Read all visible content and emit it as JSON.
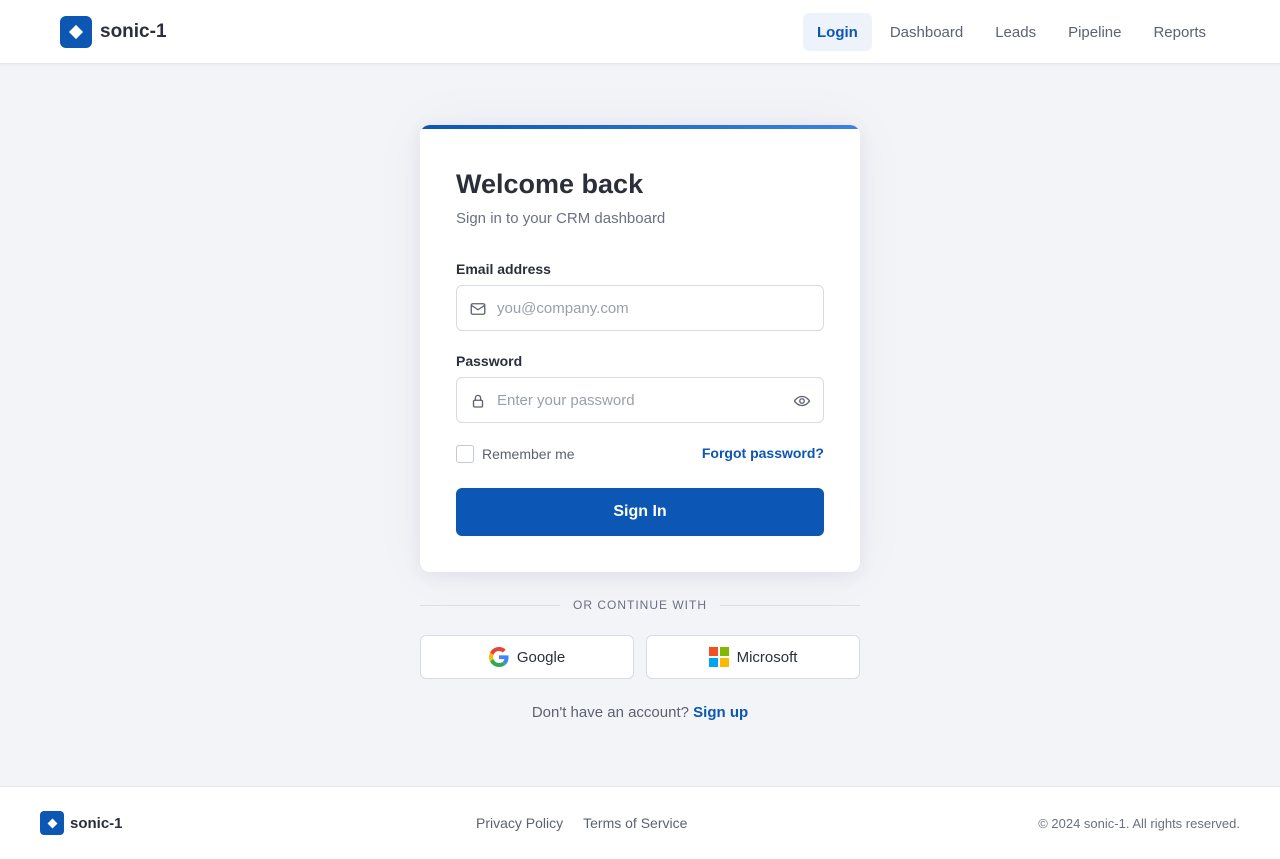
{
  "header": {
    "brand": "sonic-1",
    "nav": [
      {
        "label": "Login",
        "active": true
      },
      {
        "label": "Dashboard",
        "active": false
      },
      {
        "label": "Leads",
        "active": false
      },
      {
        "label": "Pipeline",
        "active": false
      },
      {
        "label": "Reports",
        "active": false
      }
    ]
  },
  "login": {
    "title": "Welcome back",
    "subtitle": "Sign in to your CRM dashboard",
    "email_label": "Email address",
    "email_placeholder": "you@company.com",
    "email_value": "",
    "password_label": "Password",
    "password_placeholder": "Enter your password",
    "password_value": "",
    "remember_label": "Remember me",
    "remember_checked": false,
    "forgot_label": "Forgot password?",
    "submit_label": "Sign In"
  },
  "social": {
    "divider_text": "OR CONTINUE WITH",
    "google_label": "Google",
    "microsoft_label": "Microsoft"
  },
  "signup": {
    "prompt": "Don't have an account?",
    "link_label": "Sign up"
  },
  "footer": {
    "brand": "sonic-1",
    "links": [
      "Privacy Policy",
      "Terms of Service"
    ],
    "copyright": "© 2024 sonic-1. All rights reserved."
  },
  "icons": {
    "email_field": "mail-icon",
    "password_field": "lock-icon",
    "password_toggle": "eye-icon",
    "google": "google-logo-icon",
    "microsoft": "microsoft-logo-icon",
    "brand": "diamond-logo-icon"
  },
  "colors": {
    "primary": "#0b57b3",
    "background": "#f3f4f8",
    "card": "#ffffff",
    "ms_red": "#f25022",
    "ms_green": "#7fba00",
    "ms_blue": "#00a4ef",
    "ms_yellow": "#ffb900"
  }
}
